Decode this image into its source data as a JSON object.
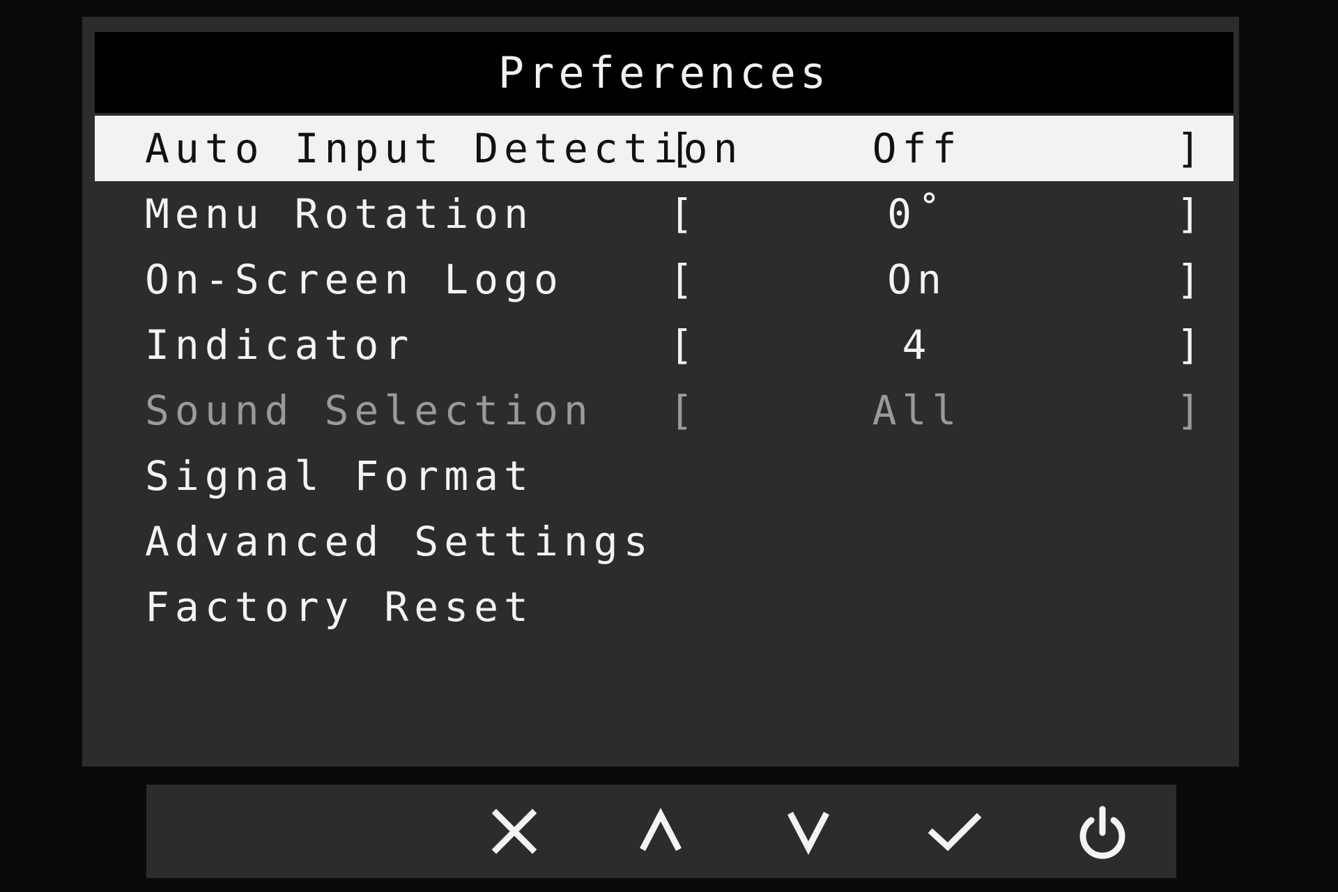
{
  "header": {
    "title": "Preferences"
  },
  "menu": {
    "items": [
      {
        "label": "Auto Input Detection",
        "open": "[",
        "value": "Off",
        "close": "]",
        "state": "selected"
      },
      {
        "label": "Menu Rotation",
        "open": "[",
        "value": "0˚",
        "close": "]",
        "state": "normal"
      },
      {
        "label": "On-Screen Logo",
        "open": "[",
        "value": "On",
        "close": "]",
        "state": "normal"
      },
      {
        "label": "Indicator",
        "open": "[",
        "value": "4",
        "close": "]",
        "state": "normal"
      },
      {
        "label": "Sound Selection",
        "open": "[",
        "value": "All",
        "close": "]",
        "state": "disabled"
      },
      {
        "label": "Signal Format",
        "state": "normal"
      },
      {
        "label": "Advanced Settings",
        "state": "normal"
      },
      {
        "label": "Factory Reset",
        "state": "normal"
      }
    ]
  },
  "buttons": [
    {
      "name": "close-icon"
    },
    {
      "name": "chevron-up-icon"
    },
    {
      "name": "chevron-down-icon"
    },
    {
      "name": "checkmark-icon"
    },
    {
      "name": "power-icon"
    }
  ],
  "colors": {
    "panel": "#2c2c2c",
    "header": "#000000",
    "selected_row": "#f2f2f2",
    "text": "#f4f4f4",
    "disabled_text": "#9a9a9a"
  }
}
